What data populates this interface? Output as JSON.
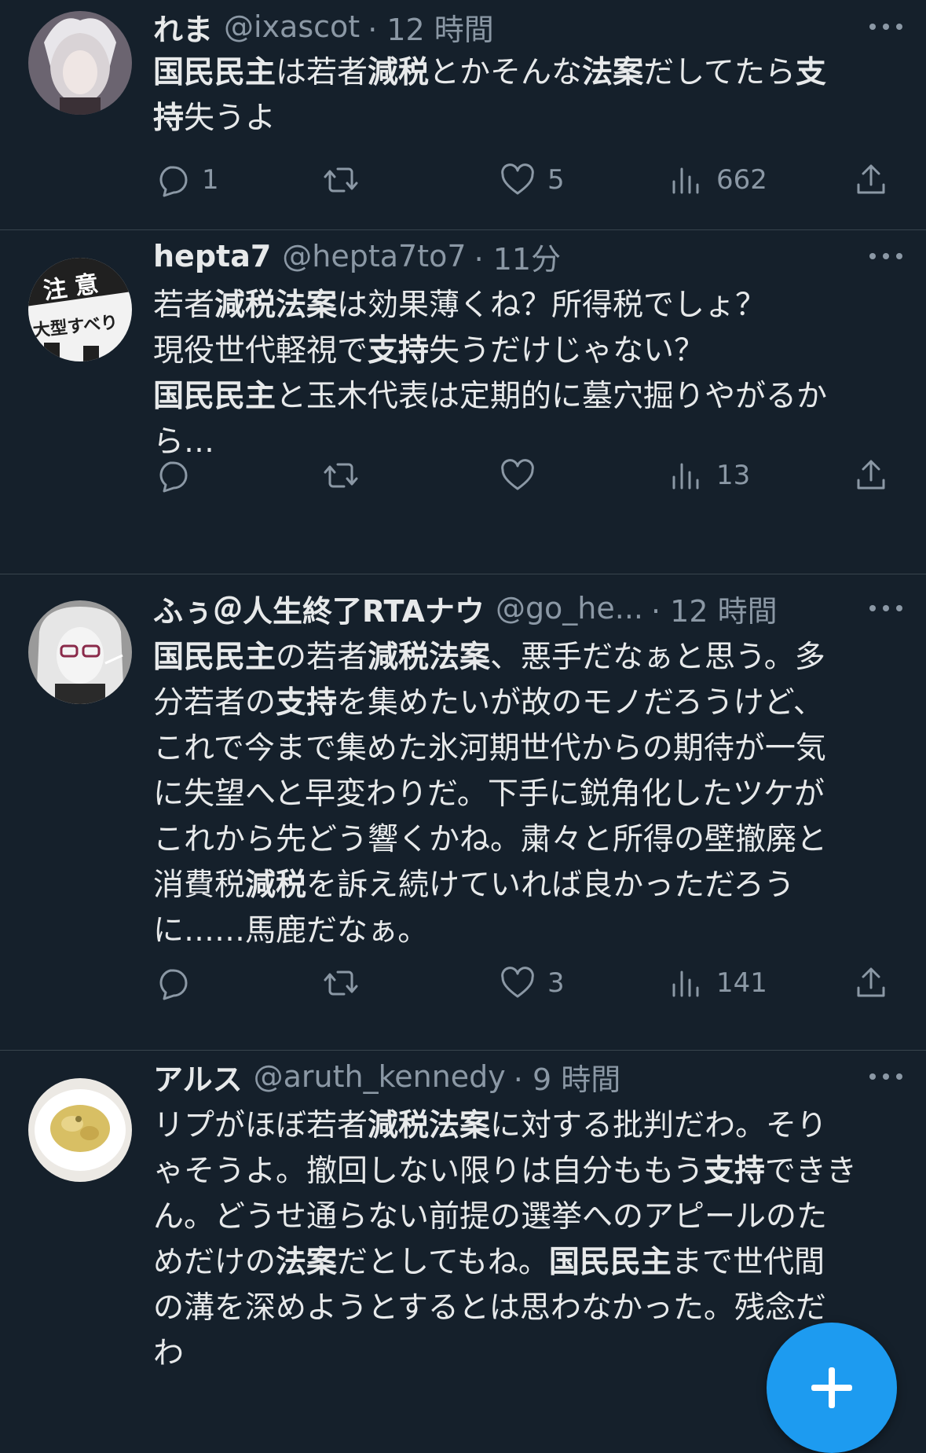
{
  "tweets": [
    {
      "name": "れま",
      "handle": "@ixascot",
      "time": "· 12 時間",
      "body": [
        [
          [
            "国民民主",
            true
          ],
          [
            "は若者",
            false
          ],
          [
            "減税",
            true
          ],
          [
            "とかそんな",
            false
          ],
          [
            "法案",
            true
          ],
          [
            "だしてたら",
            false
          ],
          [
            "支",
            true
          ]
        ],
        [
          [
            "持",
            true
          ],
          [
            "失うよ",
            false
          ]
        ]
      ],
      "stats": {
        "replies": "1",
        "retweets": "",
        "likes": "5",
        "views": "662"
      }
    },
    {
      "name": "hepta7",
      "handle": "@hepta7to7",
      "time": "· 11分",
      "body": [
        [
          [
            "若者",
            false
          ],
          [
            "減税法案",
            true
          ],
          [
            "は効果薄くね？所得税でしょ？",
            false
          ]
        ],
        [
          [
            "現役世代軽視で",
            false
          ],
          [
            "支持",
            true
          ],
          [
            "失うだけじゃない？",
            false
          ]
        ],
        [
          [
            "国民民主",
            true
          ],
          [
            "と玉木代表は定期的に墓穴掘りやがるか",
            false
          ]
        ],
        [
          [
            "ら…",
            false
          ]
        ]
      ],
      "stats": {
        "replies": "",
        "retweets": "",
        "likes": "",
        "views": "13"
      }
    },
    {
      "name": "ふぅ＠人生終了RTAナウ",
      "handle": "@go_he...",
      "time": "· 12 時間",
      "body": [
        [
          [
            "国民民主",
            true
          ],
          [
            "の若者",
            false
          ],
          [
            "減税法案",
            true
          ],
          [
            "、悪手だなぁと思う。多",
            false
          ]
        ],
        [
          [
            "分若者の",
            false
          ],
          [
            "支持",
            true
          ],
          [
            "を集めたいが故のモノだろうけど、",
            false
          ]
        ],
        [
          [
            "これで今まで集めた氷河期世代からの期待が一気",
            false
          ]
        ],
        [
          [
            "に失望へと早変わりだ。下手に鋭角化したツケが",
            false
          ]
        ],
        [
          [
            "これから先どう響くかね。粛々と所得の壁撤廃と",
            false
          ]
        ],
        [
          [
            "消費税",
            false
          ],
          [
            "減税",
            true
          ],
          [
            "を訴え続けていれば良かっただろう",
            false
          ]
        ],
        [
          [
            "に……馬鹿だなぁ。",
            false
          ]
        ]
      ],
      "stats": {
        "replies": "",
        "retweets": "",
        "likes": "3",
        "views": "141"
      }
    },
    {
      "name": "アルス",
      "handle": "@aruth_kennedy",
      "time": "· 9 時間",
      "body": [
        [
          [
            "リプがほぼ若者",
            false
          ],
          [
            "減税法案",
            true
          ],
          [
            "に対する批判だわ。そり",
            false
          ]
        ],
        [
          [
            "ゃそうよ。撤回しない限りは自分ももう",
            false
          ],
          [
            "支持",
            true
          ],
          [
            "できき",
            false
          ]
        ],
        [
          [
            "ん。どうせ通らない前提の選挙へのアピールのた",
            false
          ]
        ],
        [
          [
            "めだけの",
            false
          ],
          [
            "法案",
            true
          ],
          [
            "だとしてもね。",
            false
          ],
          [
            "国民民主",
            true
          ],
          [
            "まで世代間",
            false
          ]
        ],
        [
          [
            "の溝を深めようとするとは思わなかった。残念だ",
            false
          ]
        ],
        [
          [
            "わ",
            false
          ]
        ]
      ],
      "stats": {
        "replies": "",
        "retweets": "",
        "likes": "",
        "views": ""
      }
    }
  ],
  "icons": {
    "reply": "reply-icon",
    "retweet": "retweet-icon",
    "like": "heart-icon",
    "views": "views-icon",
    "share": "share-icon",
    "more": "more-icon",
    "compose": "compose-plus-icon"
  },
  "colors": {
    "background": "#15202b",
    "text": "#e7e9ea",
    "muted": "#8b98a5",
    "divider": "#38444d",
    "accent": "#1d9bf0"
  }
}
